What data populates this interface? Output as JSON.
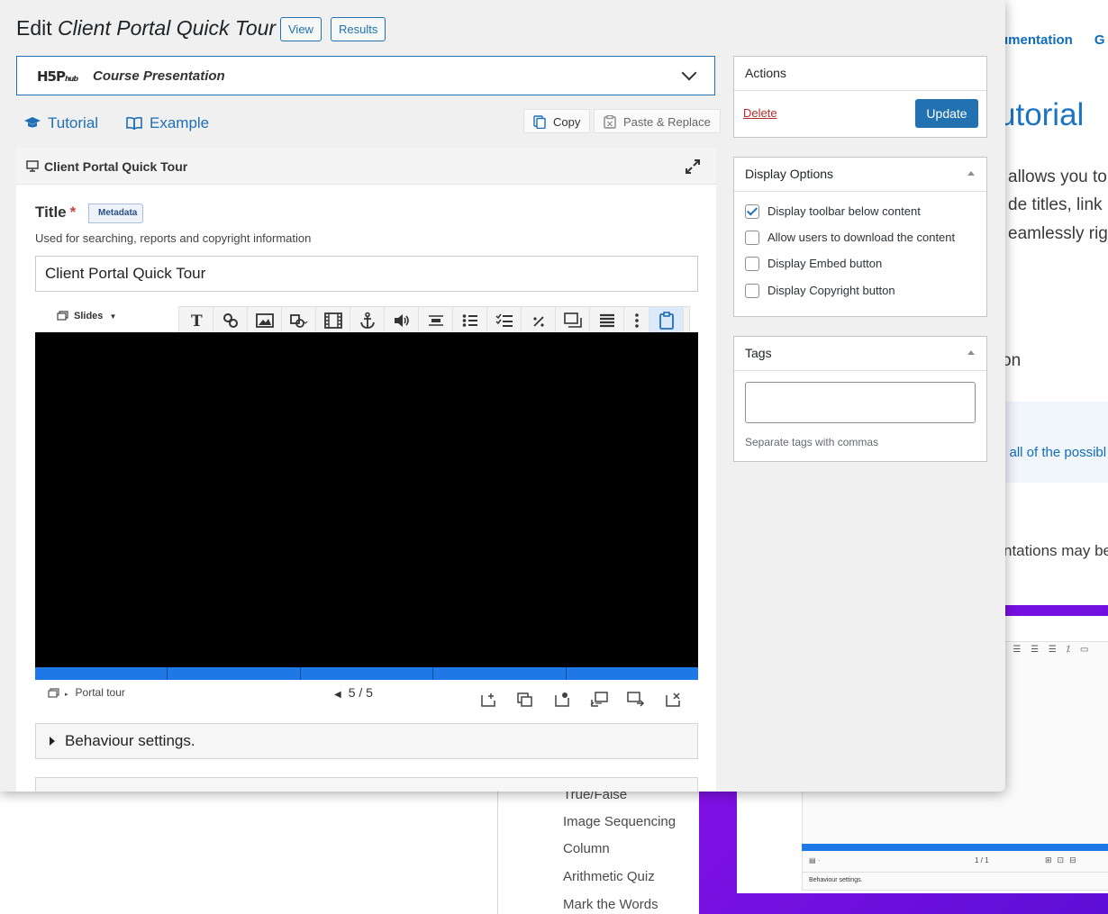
{
  "background_page": {
    "nav_items": [
      "umentation",
      "G"
    ],
    "heading": "utorial",
    "paragraph_lines": [
      "allows you to",
      "de titles, link",
      "eamlessly rig"
    ],
    "fragment_on": "on",
    "callout_link": "e all of the possibl",
    "fragment_presentations": "ntations may be",
    "sidebar_items": [
      "True/False",
      "Image Sequencing",
      "Column",
      "Arithmetic Quiz",
      "Mark the Words"
    ],
    "mini_preview": {
      "counter": "1 / 1",
      "behaviour": "Behaviour settings."
    }
  },
  "editor": {
    "title_prefix": "Edit",
    "title_name": "Client Portal Quick Tour",
    "view_button": "View",
    "results_button": "Results",
    "content_type": {
      "logo": "H5P",
      "logo_suffix": "hub",
      "name": "Course Presentation"
    },
    "tutorial_link": "Tutorial",
    "example_link": "Example",
    "copy_button": "Copy",
    "paste_button": "Paste & Replace",
    "section_title": "Client Portal Quick Tour",
    "title_field": {
      "label": "Title",
      "required_mark": "*",
      "metadata_button": "Metadata",
      "description": "Used for searching, reports and copyright information",
      "value": "Client Portal Quick Tour"
    },
    "slides_menu": "Slides",
    "toolbar_icons": [
      "text-icon",
      "link-icon",
      "image-icon",
      "shapes-icon",
      "video-icon",
      "anchor-icon",
      "audio-icon",
      "fill-blanks-icon",
      "multiple-choice-icon",
      "checklist-icon",
      "percent-icon",
      "summary-icon",
      "list-icon",
      "more-icon",
      "paste-icon"
    ],
    "slide_nav": {
      "footer_label": "Portal tour",
      "current": "5",
      "separator": "/",
      "total": "5",
      "slide_count": 5
    },
    "behaviour_label": "Behaviour settings.",
    "accent_color": "#1e78e6"
  },
  "sidebar": {
    "actions": {
      "heading": "Actions",
      "delete": "Delete",
      "update": "Update"
    },
    "display_options": {
      "heading": "Display Options",
      "options": [
        {
          "label": "Display toolbar below content",
          "checked": true
        },
        {
          "label": "Allow users to download the content",
          "checked": false
        },
        {
          "label": "Display Embed button",
          "checked": false
        },
        {
          "label": "Display Copyright button",
          "checked": false
        }
      ]
    },
    "tags": {
      "heading": "Tags",
      "hint": "Separate tags with commas",
      "value": ""
    }
  }
}
